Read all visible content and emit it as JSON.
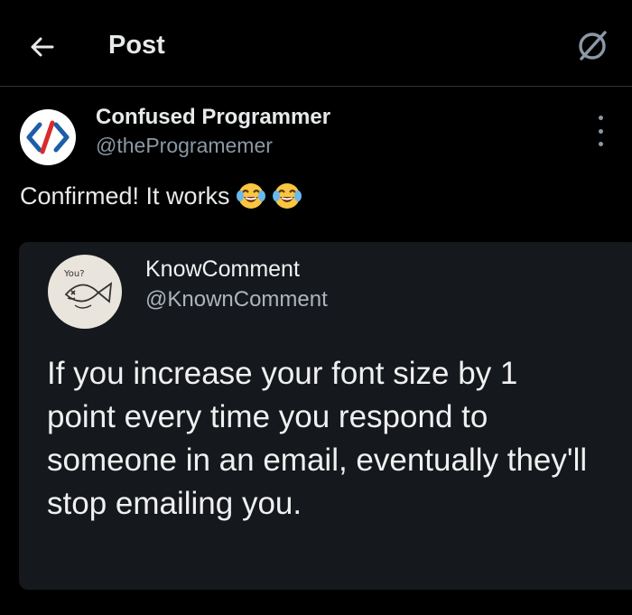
{
  "header": {
    "title": "Post",
    "back_icon": "arrow-left-icon",
    "grok_icon": "grok-icon"
  },
  "post": {
    "author_name": "Confused Programmer",
    "author_handle": "@theProgramemer",
    "text": "Confirmed! It works",
    "emojis": [
      "face-with-tears-of-joy",
      "face-with-tears-of-joy"
    ],
    "more_icon": "more-vertical-icon"
  },
  "quoted_image": {
    "name": "KnowComment",
    "handle": "@KnownComment",
    "avatar_scribble": "You?",
    "text": "If you increase your font size by 1 point every time you respond to someone in an email, eventually they'll stop emailing you."
  },
  "colors": {
    "background": "#000000",
    "text_primary": "#e7e9ea",
    "text_secondary": "#8b98a5",
    "divider": "#2f3336",
    "media_background": "#15181d"
  }
}
